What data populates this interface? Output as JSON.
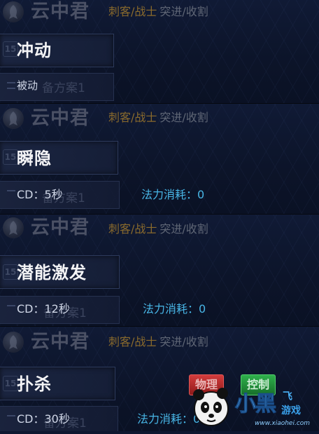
{
  "hero": {
    "name": "云中君",
    "role": "刺客/战士",
    "tags": "突进/收割"
  },
  "panels": [
    {
      "skill_name": "冲动",
      "level_badge": "15",
      "sub_label": "被动",
      "faded_text": "备方案1"
    },
    {
      "skill_name": "瞬隐",
      "level_badge": "15",
      "cd": "CD：5秒",
      "mana": "法力消耗：0",
      "faded_text": "备方案1"
    },
    {
      "skill_name": "潜能激发",
      "level_badge": "15",
      "cd": "CD：12秒",
      "mana": "法力消耗：0",
      "faded_text": "备方案1"
    },
    {
      "skill_name": "扑杀",
      "level_badge": "15",
      "cd": "CD：30秒",
      "mana": "法力消耗：0",
      "faded_text": "备方案1",
      "tag_physical": "物理",
      "tag_control": "控制"
    }
  ],
  "watermark": {
    "text_main": "小黑",
    "text_side1": "飞",
    "text_side2": "游戏",
    "url": "www.xiaohei.com"
  },
  "colors": {
    "background": "#0e1730",
    "role_color": "#8a6a2c",
    "mana_color": "#48b6e6",
    "tag_red": "#d23c3c",
    "tag_green": "#2fb04c"
  }
}
